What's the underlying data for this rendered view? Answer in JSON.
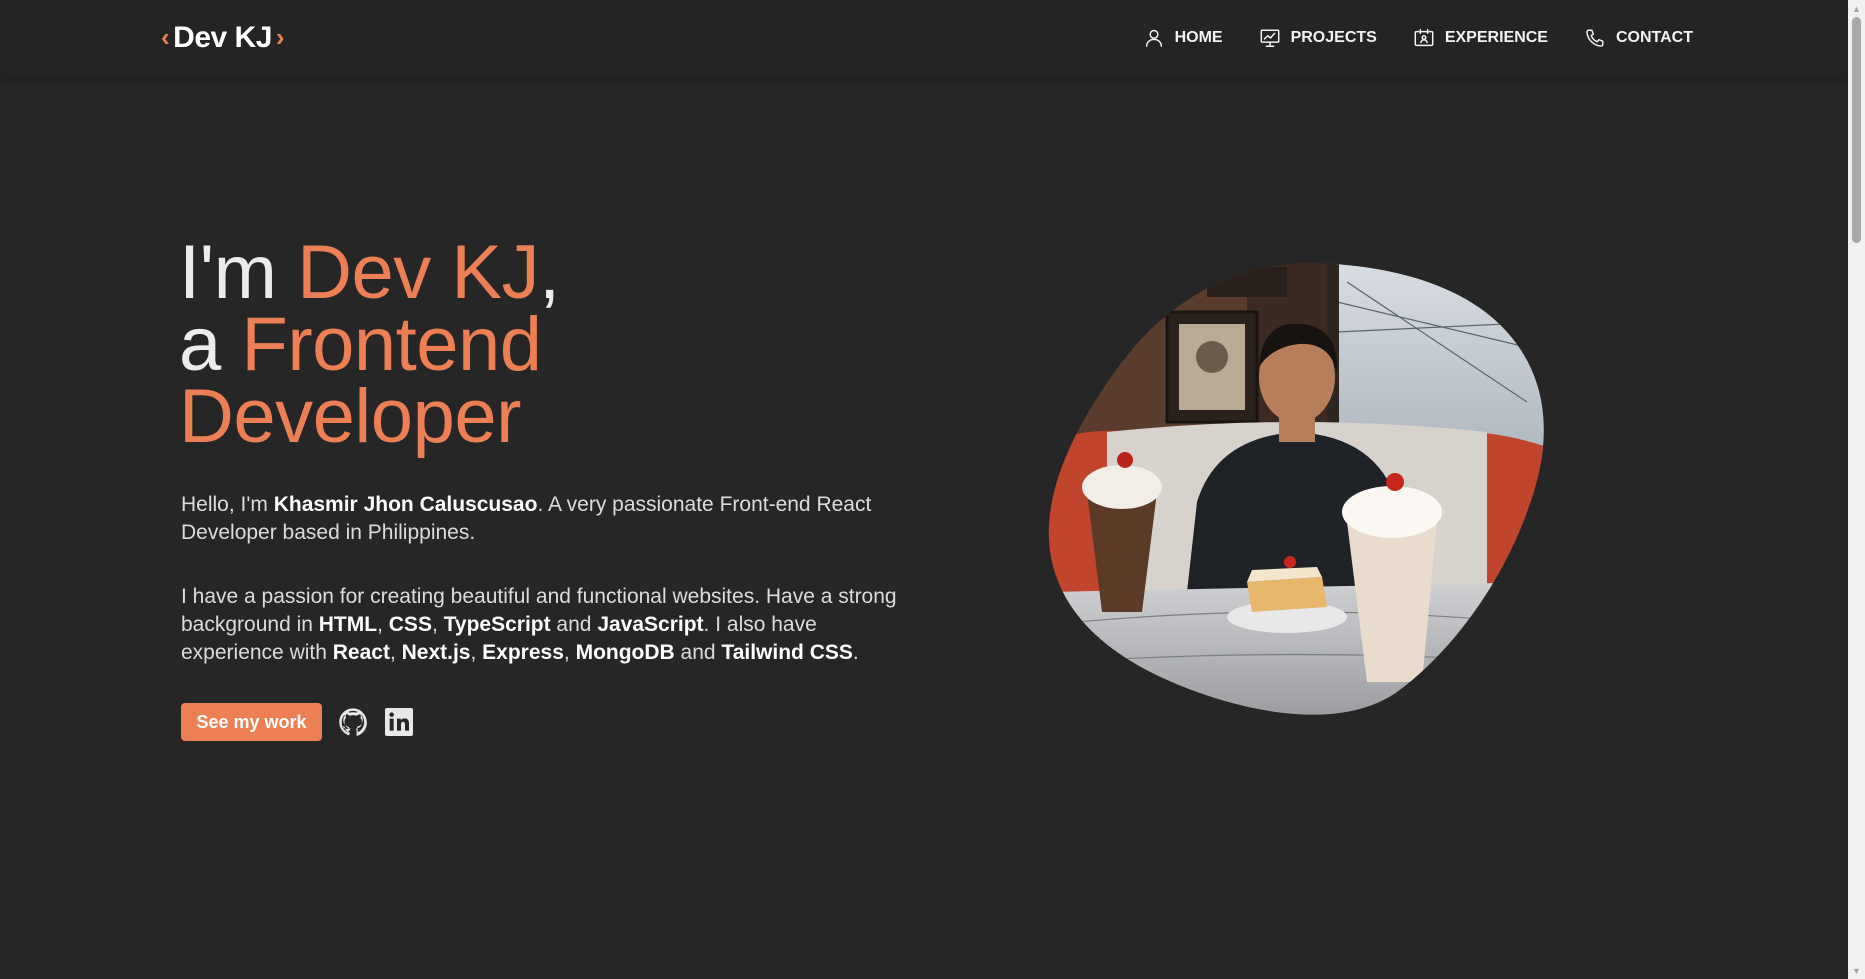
{
  "navbar": {
    "logo": {
      "left_bracket": "‹",
      "text": "Dev KJ",
      "right_bracket": "›"
    },
    "items": [
      {
        "label": "HOME",
        "icon": "user-icon"
      },
      {
        "label": "PROJECTS",
        "icon": "presentation-icon"
      },
      {
        "label": "EXPERIENCE",
        "icon": "id-card-icon"
      },
      {
        "label": "CONTACT",
        "icon": "phone-icon"
      }
    ]
  },
  "hero": {
    "title": {
      "line1_prefix": "I'm ",
      "line1_accent": "Dev KJ",
      "line1_suffix": ",",
      "line2_prefix": "a ",
      "line2_accent": "Frontend",
      "line3_accent": "Developer"
    },
    "intro": {
      "t1": "Hello, I'm ",
      "name": "Khasmir Jhon Caluscusao",
      "t2": ". A very passionate Front-end React Developer based in Philippines."
    },
    "skills": {
      "t1": "I have a passion for creating beautiful and functional websites. Have a strong background in ",
      "s1": "HTML",
      "c1": ", ",
      "s2": "CSS",
      "c2": ", ",
      "s3": "TypeScript",
      "c3": " and ",
      "s4": "JavaScript",
      "t2": ". I also have experience with ",
      "s5": "React",
      "c4": ", ",
      "s6": "Next.js",
      "c5": ", ",
      "s7": "Express",
      "c6": ", ",
      "s8": "MongoDB",
      "c7": " and ",
      "s9": "Tailwind CSS",
      "t3": "."
    },
    "cta_label": "See my work",
    "social": [
      {
        "icon": "github-icon"
      },
      {
        "icon": "linkedin-icon"
      }
    ]
  },
  "colors": {
    "background": "#262626",
    "navbar": "#242424",
    "accent": "#ec7f53",
    "text": "#e5e5e5"
  }
}
